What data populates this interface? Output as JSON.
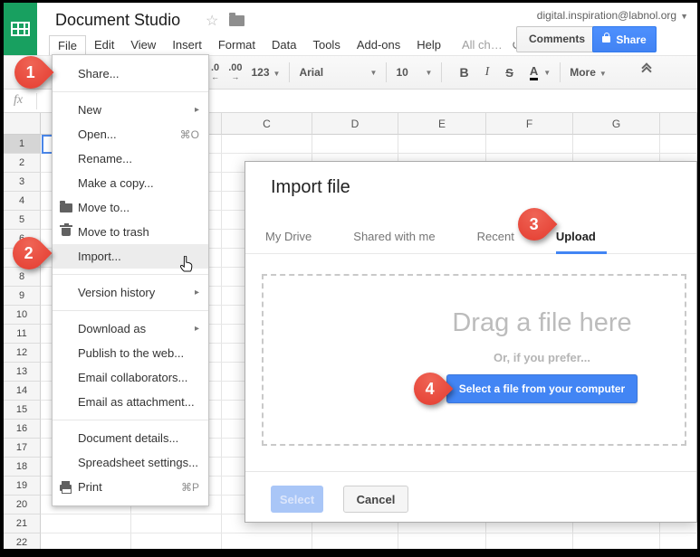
{
  "titlebar": {
    "title": "Document Studio",
    "account": "digital.inspiration@labnol.org"
  },
  "menubar": {
    "items": [
      "File",
      "Edit",
      "View",
      "Insert",
      "Format",
      "Data",
      "Tools",
      "Add-ons",
      "Help"
    ],
    "active_item": "File",
    "all_changes": "All ch…",
    "comments": "Comments",
    "share": "Share"
  },
  "toolbar": {
    "decrease_decimal": ".0",
    "increase_decimal": ".00",
    "number_format": "123",
    "font": "Arial",
    "size": "10",
    "bold": "B",
    "italic": "I",
    "strikethrough": "S",
    "text_color": "A",
    "more": "More"
  },
  "formula_bar": {
    "label": "fx"
  },
  "grid": {
    "columns": [
      "",
      "",
      "C",
      "D",
      "E",
      "F",
      "G",
      ""
    ],
    "rows": [
      "1",
      "2",
      "3",
      "4",
      "5",
      "6",
      "7",
      "8",
      "9",
      "10",
      "11",
      "12",
      "13",
      "14",
      "15",
      "16",
      "17",
      "18",
      "19",
      "20",
      "21",
      "22"
    ]
  },
  "file_menu": {
    "items": [
      {
        "label": "Share..."
      },
      {
        "separator": true
      },
      {
        "label": "New",
        "submenu": true
      },
      {
        "label": "Open...",
        "shortcut": "⌘O"
      },
      {
        "label": "Rename..."
      },
      {
        "label": "Make a copy..."
      },
      {
        "label": "Move to...",
        "icon": "folder"
      },
      {
        "label": "Move to trash",
        "icon": "trash"
      },
      {
        "label": "Import...",
        "highlighted": true
      },
      {
        "separator": true
      },
      {
        "label": "Version history",
        "submenu": true
      },
      {
        "separator": true
      },
      {
        "label": "Download as",
        "submenu": true
      },
      {
        "label": "Publish to the web..."
      },
      {
        "label": "Email collaborators..."
      },
      {
        "label": "Email as attachment..."
      },
      {
        "separator": true
      },
      {
        "label": "Document details..."
      },
      {
        "label": "Spreadsheet settings..."
      },
      {
        "label": "Print",
        "shortcut": "⌘P",
        "icon": "printer"
      }
    ]
  },
  "dialog": {
    "title": "Import file",
    "tabs": [
      {
        "label": "My Drive"
      },
      {
        "label": "Shared with me"
      },
      {
        "label": "Recent"
      },
      {
        "label": "Upload",
        "active": true
      }
    ],
    "dropzone": {
      "heading": "Drag a file here",
      "subtext": "Or, if you prefer...",
      "button": "Select a file from your computer"
    },
    "footer": {
      "select": "Select",
      "cancel": "Cancel"
    }
  },
  "annotations": {
    "steps": [
      "1",
      "2",
      "3",
      "4"
    ]
  },
  "colors": {
    "brand_green": "#18a060",
    "accent_blue": "#4285f4",
    "share_blue": "#4d90fe",
    "arrow_red": "#e8463c"
  }
}
